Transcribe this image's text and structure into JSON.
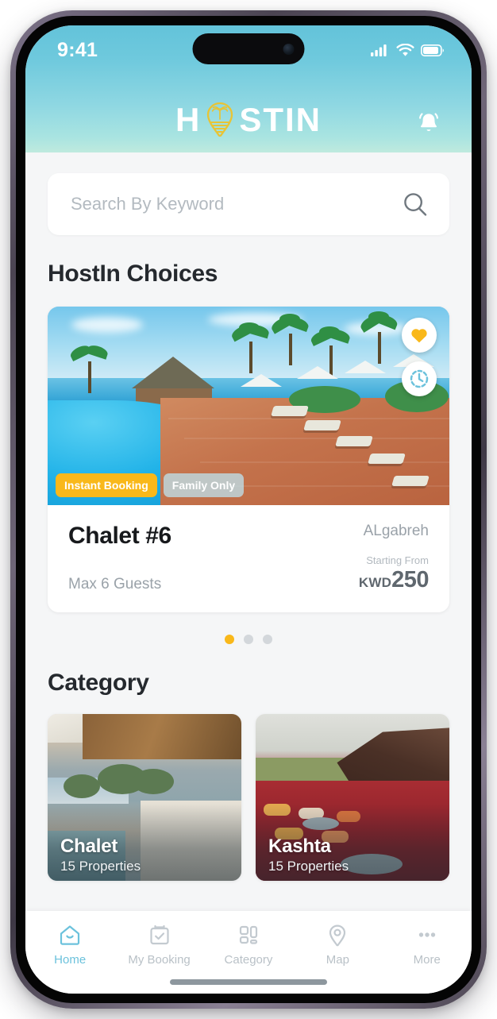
{
  "status_bar": {
    "time": "9:41",
    "icons": [
      "cellular-signal-icon",
      "wifi-icon",
      "battery-icon"
    ]
  },
  "header": {
    "brand_prefix": "H",
    "brand_suffix": "STIN",
    "logo_icon": "palm-tree-pin-logo",
    "notification_icon": "bell-icon",
    "gradient_top": "#63c3da",
    "gradient_bottom": "#bfeade"
  },
  "search": {
    "placeholder": "Search By Keyword",
    "value": "",
    "icon": "search-icon"
  },
  "choices_section": {
    "title": "HostIn Choices",
    "card": {
      "photo_alt": "resort-pool-photo",
      "badges": [
        {
          "label": "Instant Booking",
          "color": "#f9b81a"
        },
        {
          "label": "Family Only",
          "color": "#bedfe9"
        }
      ],
      "actions": [
        {
          "name": "favorite-button",
          "icon": "heart-icon",
          "color": "#f9b81a"
        },
        {
          "name": "instant-booking-button",
          "icon": "clock-icon",
          "color": "#6cc2dc"
        }
      ],
      "title": "Chalet #6",
      "guests": "Max 6 Guests",
      "location": "ALgabreh",
      "price_label": "Starting From",
      "price_currency": "KWD",
      "price_amount": "250"
    },
    "dots": [
      {
        "active": true
      },
      {
        "active": false
      },
      {
        "active": false
      }
    ],
    "active_dot_color": "#f9b81a"
  },
  "category_section": {
    "title": "Category",
    "cards": [
      {
        "name": "Chalet",
        "count": "15 Properties",
        "photo_alt": "modern-villa-pool-photo"
      },
      {
        "name": "Kashta",
        "count": "15 Properties",
        "photo_alt": "bedouin-tent-carpet-photo"
      }
    ]
  },
  "bottom_nav": {
    "active_color": "#6cc2dc",
    "inactive_color": "#b9c1c7",
    "items": [
      {
        "label": "Home",
        "icon": "home-icon",
        "active": true
      },
      {
        "label": "My Booking",
        "icon": "calendar-check-icon",
        "active": false
      },
      {
        "label": "Category",
        "icon": "grid-icon",
        "active": false
      },
      {
        "label": "Map",
        "icon": "map-pin-icon",
        "active": false
      },
      {
        "label": "More",
        "icon": "ellipsis-icon",
        "active": false
      }
    ]
  }
}
